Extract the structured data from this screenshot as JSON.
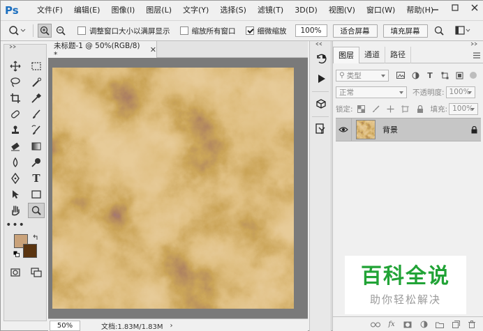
{
  "app": {
    "logo": "Ps",
    "brand_color": "#1c6fbf"
  },
  "menu": [
    "文件(F)",
    "编辑(E)",
    "图像(I)",
    "图层(L)",
    "文字(Y)",
    "选择(S)",
    "滤镜(T)",
    "3D(D)",
    "视图(V)",
    "窗口(W)",
    "帮助(H)"
  ],
  "window_controls": {
    "minimize": "minimize-icon",
    "maximize": "maximize-icon",
    "close": "close-icon"
  },
  "options": {
    "resize_windows_label": "调整窗口大小以满屏显示",
    "resize_windows_checked": false,
    "zoom_all_label": "缩放所有窗口",
    "zoom_all_checked": false,
    "scrubby_zoom_label": "细微缩放",
    "scrubby_zoom_checked": true,
    "zoom_value": "100%",
    "fit_screen_label": "适合屏幕",
    "fill_screen_label": "填充屏幕"
  },
  "document": {
    "tab_title": "未标题-1 @ 50%(RGB/8) *",
    "zoom": "50%",
    "doc_info": "文档:1.83M/1.83M"
  },
  "swatches": {
    "foreground": "#c9a27a",
    "background": "#5a3410"
  },
  "layers_panel": {
    "tabs": [
      "图层",
      "通道",
      "路径"
    ],
    "active_tab": 0,
    "filter_kind": "类型",
    "blend_mode": "正常",
    "opacity_label": "不透明度:",
    "opacity_value": "100%",
    "lock_label": "锁定:",
    "fill_label": "填充:",
    "fill_value": "100%",
    "layers": [
      {
        "name": "背景",
        "visible": true,
        "locked": true
      }
    ]
  },
  "watermark": {
    "title": "百科全说",
    "subtitle": "助你轻松解决",
    "color": "#21a336"
  }
}
